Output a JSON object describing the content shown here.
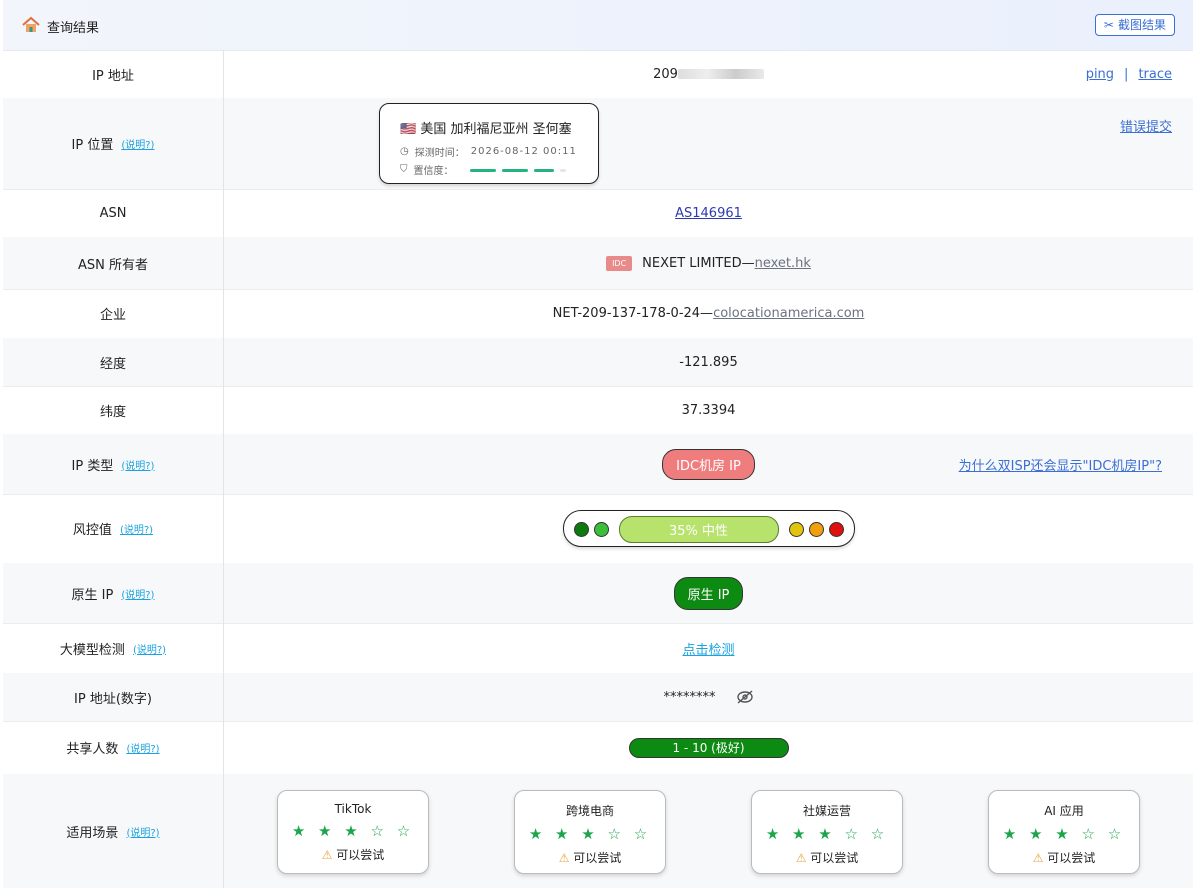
{
  "header": {
    "title": "查询结果",
    "screenshot_button": "截图结果"
  },
  "help_text": "(说明?)",
  "rows": {
    "ip": {
      "label": "IP 地址",
      "value_prefix": "209",
      "ping": "ping",
      "sep": "|",
      "trace": "trace"
    },
    "location": {
      "label": "IP 位置",
      "place": "🇺🇸 美国 加利福尼亚州 圣何塞",
      "detect_label": "探测时间：",
      "detect_time": "2026-08-12 00:11",
      "confidence_label": "置信度：",
      "confidence": 0.85,
      "report_link": "错误提交"
    },
    "asn": {
      "label": "ASN",
      "value": "AS146961"
    },
    "asn_owner": {
      "label": "ASN 所有者",
      "badge": "IDC",
      "name": "NEXET LIMITED— ",
      "domain": "nexet.hk"
    },
    "enterprise": {
      "label": "企业",
      "name": "NET-209-137-178-0-24— ",
      "domain": "colocationamerica.com"
    },
    "longitude": {
      "label": "经度",
      "value": "-121.895"
    },
    "latitude": {
      "label": "纬度",
      "value": "37.3394"
    },
    "ip_type": {
      "label": "IP 类型",
      "value": "IDC机房 IP",
      "why_link": "为什么双ISP还会显示\"IDC机房IP\"?"
    },
    "risk": {
      "label": "风控值",
      "value": "35%  中性",
      "percent": 35
    },
    "native": {
      "label": "原生 IP",
      "value": "原生 IP"
    },
    "llm": {
      "label": "大模型检测",
      "value": "点击检测"
    },
    "ip_numeric": {
      "label": "IP 地址(数字)",
      "value": "********"
    },
    "shared": {
      "label": "共享人数",
      "value": "1 - 10 (极好)"
    },
    "scenarios": {
      "label": "适用场景",
      "cards": [
        {
          "name": "TikTok",
          "stars": "★ ★ ★ ☆ ☆",
          "status": "可以尝试"
        },
        {
          "name": "跨境电商",
          "stars": "★ ★ ★ ☆ ☆",
          "status": "可以尝试"
        },
        {
          "name": "社媒运营",
          "stars": "★ ★ ★ ☆ ☆",
          "status": "可以尝试"
        },
        {
          "name": "AI 应用",
          "stars": "★ ★ ★ ☆ ☆",
          "status": "可以尝试"
        }
      ]
    }
  },
  "colors": {
    "accent": "#3b6fd4",
    "idc_red": "#f07d7d",
    "native_green": "#0c8a11",
    "risk_bar": "#b7e26b",
    "star": "#1ba64c"
  }
}
